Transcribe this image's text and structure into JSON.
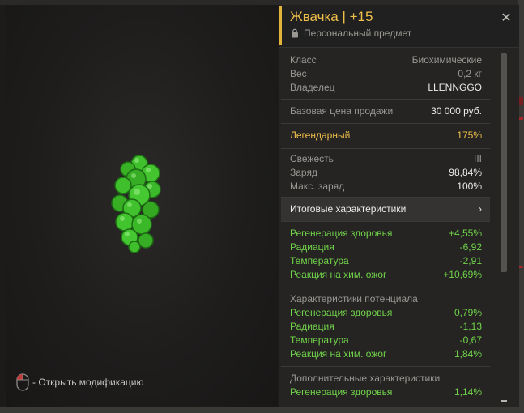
{
  "viewer": {
    "hint_text": "- Открыть модификацию"
  },
  "item": {
    "title": "Жвачка | +15",
    "subtitle": "Персональный предмет"
  },
  "info": [
    {
      "label": "Класс",
      "value": "Биохимические"
    },
    {
      "label": "Вес",
      "value": "0,2 кг"
    },
    {
      "label": "Владелец",
      "value": "LLENNGGO"
    }
  ],
  "price": {
    "label": "Базовая цена продажи",
    "value": "30 000 руб."
  },
  "rarity": {
    "label": "Легендарный",
    "value": "175%"
  },
  "state": [
    {
      "label": "Свежесть",
      "value": "III"
    },
    {
      "label": "Заряд",
      "value": "98,84%"
    },
    {
      "label": "Макс. заряд",
      "value": "100%"
    }
  ],
  "total_button": {
    "label": "Итоговые характеристики",
    "arrow": "›"
  },
  "total_stats": [
    {
      "label": "Регенерация здоровья",
      "value": "+4,55%"
    },
    {
      "label": "Радиация",
      "value": "-6,92"
    },
    {
      "label": "Температура",
      "value": "-2,91"
    },
    {
      "label": "Реакция на хим. ожог",
      "value": "+10,69%"
    }
  ],
  "potential": {
    "title": "Характеристики потенциала",
    "stats": [
      {
        "label": "Регенерация здоровья",
        "value": "0,79%"
      },
      {
        "label": "Радиация",
        "value": "-1,13"
      },
      {
        "label": "Температура",
        "value": "-0,67"
      },
      {
        "label": "Реакция на хим. ожог",
        "value": "1,84%"
      }
    ]
  },
  "additional": {
    "title": "Дополнительные характеристики",
    "stats": [
      {
        "label": "Регенерация здоровья",
        "value": "1,14%"
      }
    ]
  },
  "colors": {
    "accent": "#e2b43a",
    "legendary": "#f1c04a",
    "positive": "#71d34a"
  },
  "icons": {
    "lock": "lock-icon",
    "close": "close-icon",
    "mouse": "mouse-left-click-icon",
    "chevron": "chevron-right-icon"
  }
}
